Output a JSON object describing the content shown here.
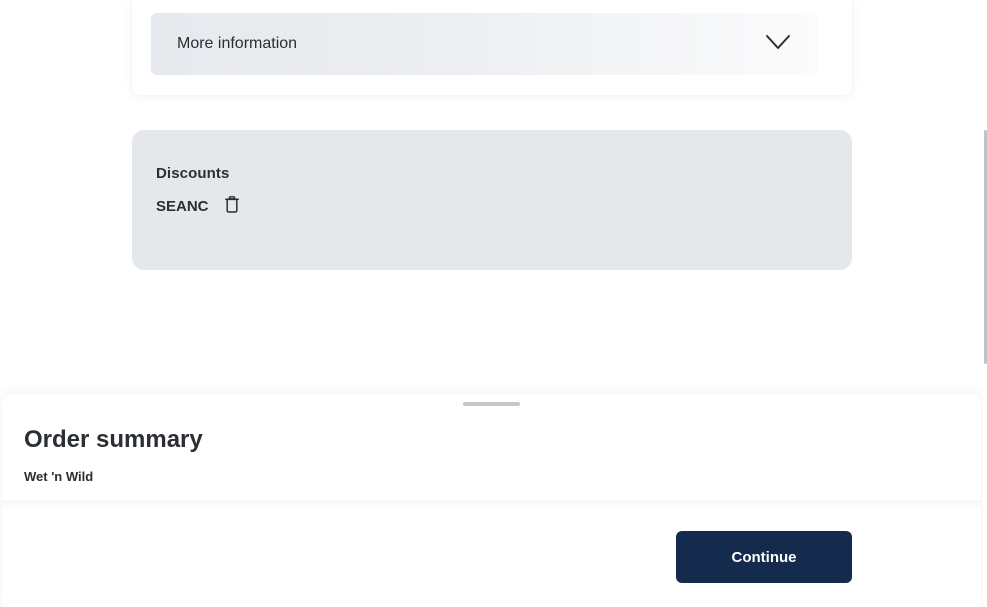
{
  "accordion": {
    "label": "More information",
    "icon": "chevron-down-icon"
  },
  "discounts": {
    "title": "Discounts",
    "code": "SEANC",
    "remove_icon": "trash-icon"
  },
  "order_summary": {
    "title": "Order summary",
    "subtitle": "Wet 'n Wild",
    "continue_label": "Continue"
  },
  "colors": {
    "primary_button": "#152b4d",
    "discount_card_bg": "#e5e8eb"
  }
}
